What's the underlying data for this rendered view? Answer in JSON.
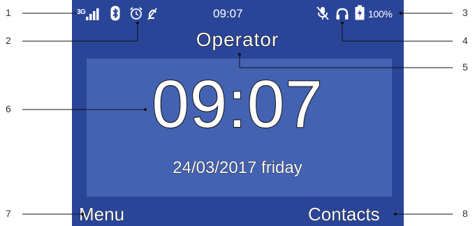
{
  "status_bar": {
    "network_type": "3G",
    "time": "09:07",
    "battery_percent": "100%",
    "left_icons": [
      "signal-strength-icon",
      "bluetooth-icon",
      "alarm-clock-icon",
      "ringer-off-icon"
    ],
    "right_icons": [
      "microphone-muted-icon",
      "headset-icon",
      "battery-charging-icon"
    ]
  },
  "operator": "Operator",
  "clock": {
    "time": "09:07",
    "date": "24/03/2017 friday"
  },
  "softkeys": {
    "left": "Menu",
    "right": "Contacts"
  },
  "callouts": {
    "c1": "1",
    "c2": "2",
    "c3": "3",
    "c4": "4",
    "c5": "5",
    "c6": "6",
    "c7": "7",
    "c8": "8"
  },
  "colors": {
    "screen_background": "#2a4598",
    "clock_panel": "#4462b2",
    "text": "#ffffff",
    "outline": "#111111"
  }
}
